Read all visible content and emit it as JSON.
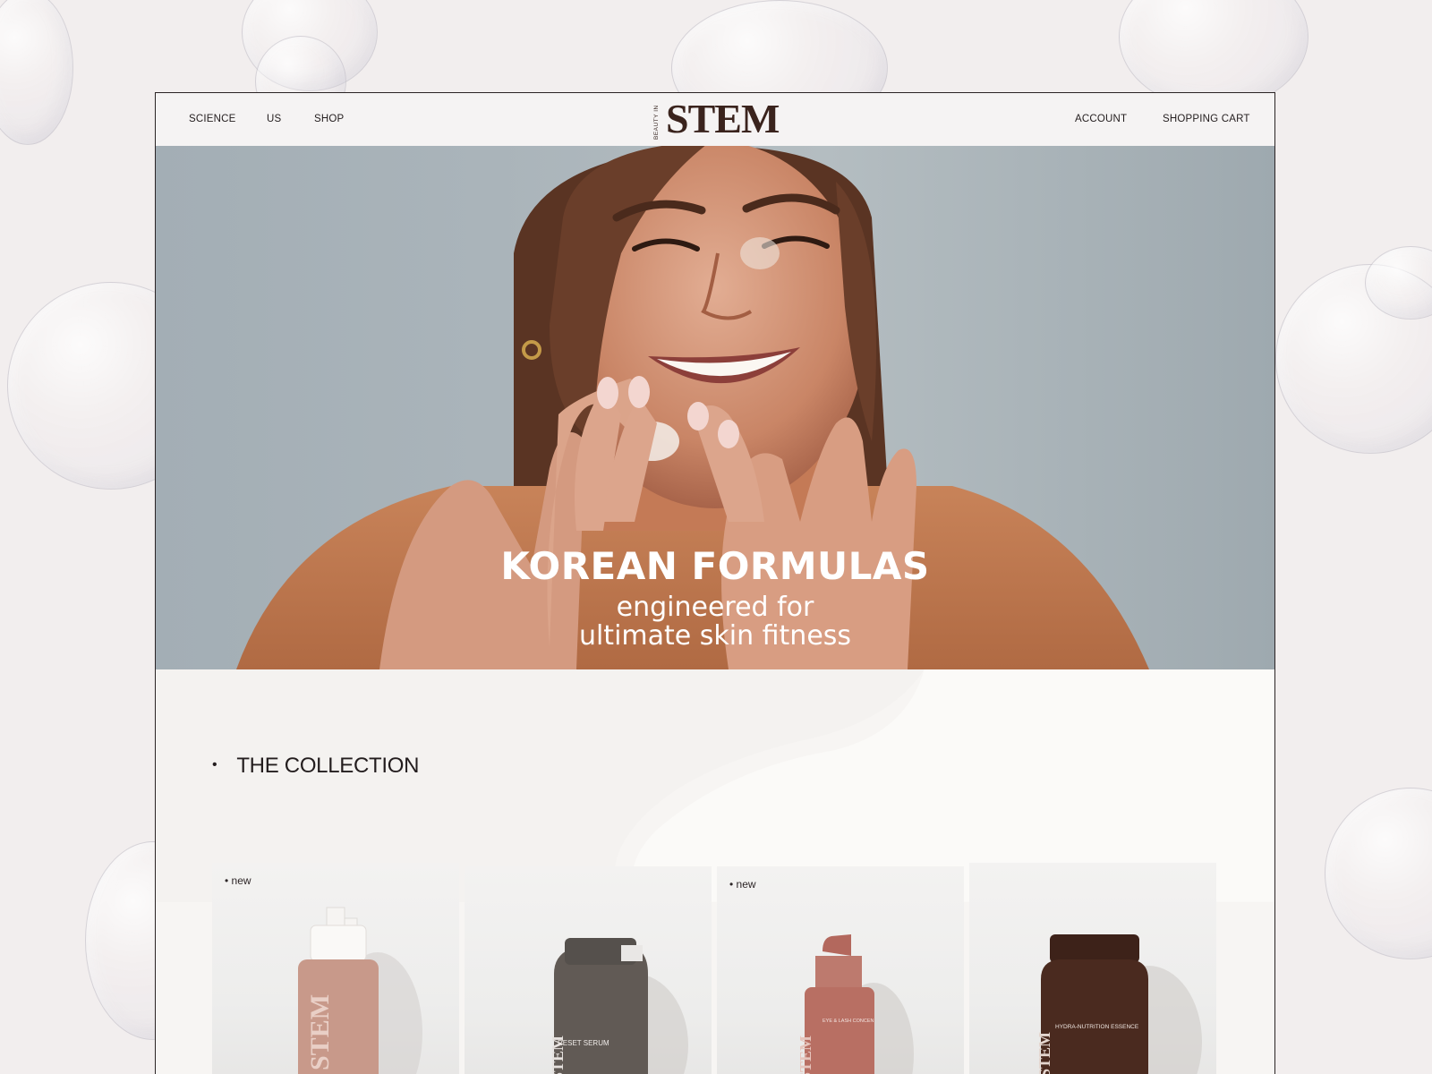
{
  "nav": {
    "left": [
      "SCIENCE",
      "US",
      "SHOP"
    ],
    "right": [
      "ACCOUNT",
      "SHOPPING CART"
    ],
    "logo_tagline": "BEAUTY IN",
    "logo_word": "STEM"
  },
  "hero": {
    "title": "KOREAN FORMULAS",
    "subtitle_line1": "engineered for",
    "subtitle_line2": "ultimate skin fitness"
  },
  "collection": {
    "heading": "THE COLLECTION",
    "products": [
      {
        "badge": "• new",
        "label": "",
        "color": "#c8998a",
        "cap": "#f4f2f0"
      },
      {
        "badge": "",
        "label": "RESET SERUM",
        "color": "#6a625d",
        "cap": "#55504c"
      },
      {
        "badge": "• new",
        "label": "EYE & LASH CONCEN",
        "color": "#b86f63",
        "cap": "#b3685d"
      },
      {
        "badge": "",
        "label": "HYDRA-NUTRITION ESSENCE",
        "color": "#4a2a1f",
        "cap": "#3d2219"
      }
    ]
  },
  "colors": {
    "accent": "#3a231d",
    "page_bg": "#f2eeee",
    "text": "#231d1e"
  }
}
